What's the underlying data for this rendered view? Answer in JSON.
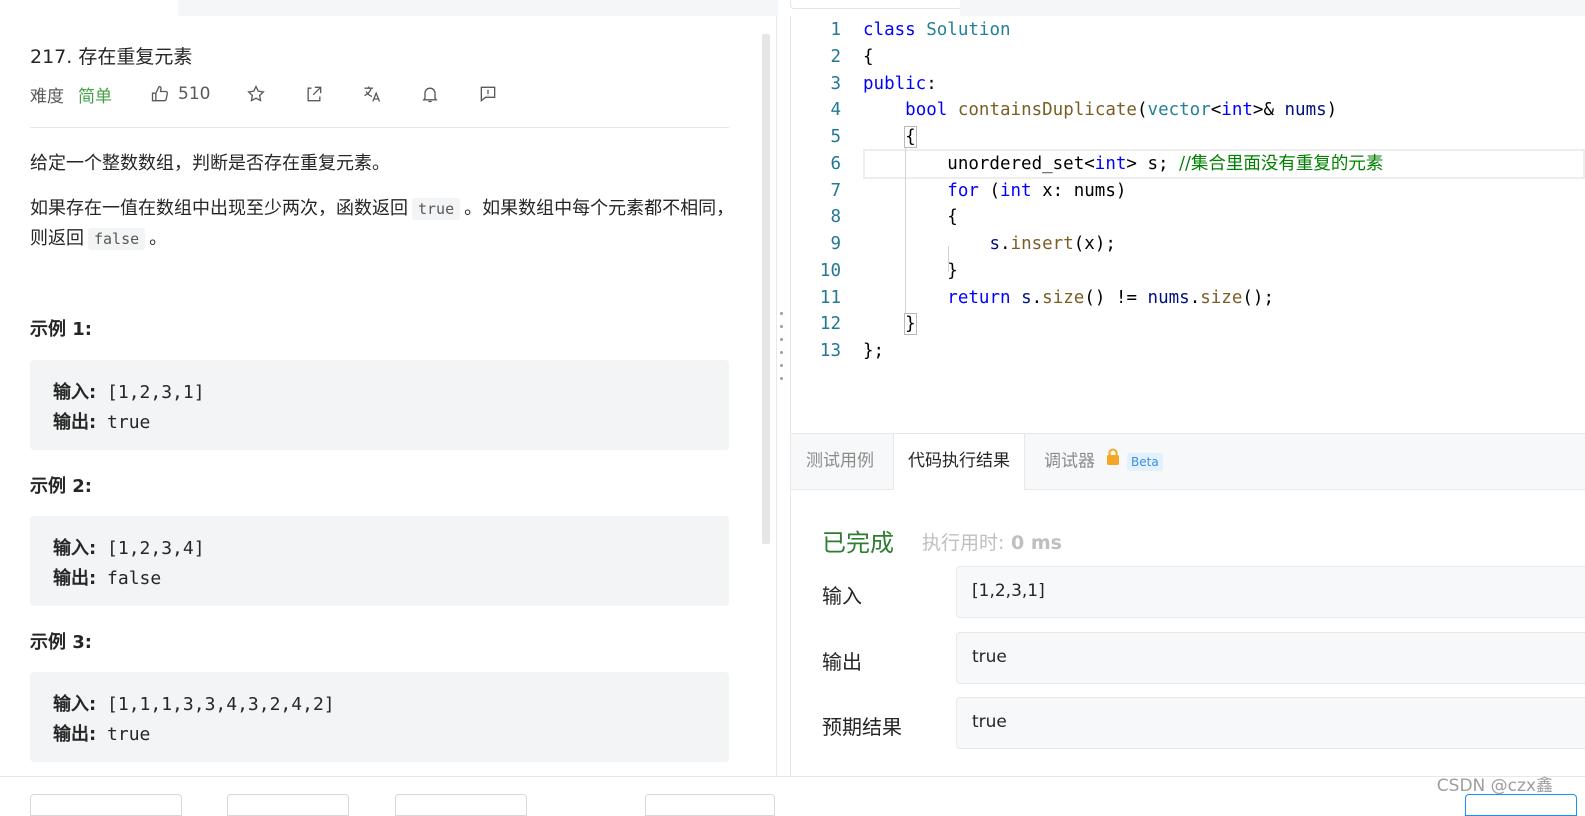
{
  "problem": {
    "title": "217. 存在重复元素",
    "difficulty_label": "难度",
    "difficulty": "简单",
    "likes": "510",
    "description_1": "给定一个整数数组，判断是否存在重复元素。",
    "description_2_a": "如果存在一值在数组中出现至少两次，函数返回",
    "description_2_code1": "true",
    "description_2_b": "。如果数组中每个元素都不相同，则返回",
    "description_2_code2": "false",
    "description_2_c": "。",
    "examples": [
      {
        "heading": "示例 1:",
        "input_label": "输入:",
        "input": " [1,2,3,1]",
        "output_label": "输出:",
        "output": " true"
      },
      {
        "heading": "示例 2:",
        "input_label": "输入:",
        "input": " [1,2,3,4]",
        "output_label": "输出:",
        "output": " false"
      },
      {
        "heading": "示例 3:",
        "input_label": "输入:",
        "input": " [1,1,1,3,3,4,3,2,4,2]",
        "output_label": "输出:",
        "output": " true"
      }
    ]
  },
  "toolbar_icons": [
    "thumbs-up-icon",
    "star-icon",
    "share-icon",
    "translate-icon",
    "bell-icon",
    "feedback-icon"
  ],
  "editor": {
    "line_numbers": [
      "1",
      "2",
      "3",
      "4",
      "5",
      "6",
      "7",
      "8",
      "9",
      "10",
      "11",
      "12",
      "13"
    ],
    "lines": [
      "class Solution",
      "{",
      "public:",
      "    bool containsDuplicate(vector<int>& nums)",
      "    {",
      "        unordered_set<int> s; //集合里面没有重复的元素",
      "        for (int x: nums)",
      "        {",
      "            s.insert(x);",
      "        }",
      "        return s.size() != nums.size();",
      "    }",
      "};"
    ]
  },
  "result_panel": {
    "tabs": [
      "测试用例",
      "代码执行结果",
      "调试器"
    ],
    "active_tab": "代码执行结果",
    "beta_label": "Beta",
    "status": "已完成",
    "time_label": "执行用时:",
    "time_value": " 0 ms",
    "input_label": "输入",
    "input_value": "[1,2,3,1]",
    "output_label": "输出",
    "output_value": "true",
    "expected_label": "预期结果",
    "expected_value": "true"
  },
  "watermark": "CSDN @czx鑫",
  "colors": {
    "easy": "#43a047",
    "done": "#2e7d32",
    "keyword": "#0000ff",
    "comment": "#008000",
    "line_number": "#237893"
  }
}
